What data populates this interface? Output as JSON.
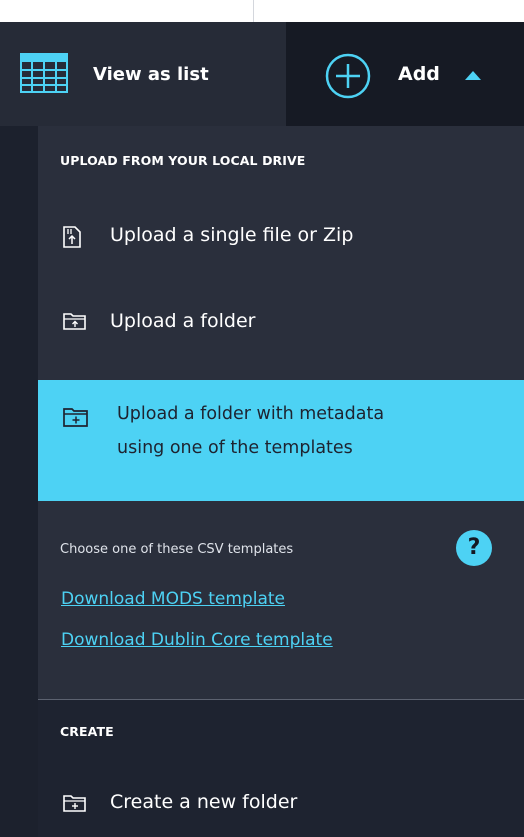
{
  "toolbar": {
    "view_as_list_label": "View as list",
    "add_label": "Add",
    "icons": {
      "view": "grid-icon",
      "add": "plus-circle-icon",
      "caret": "caret-up-icon"
    }
  },
  "upload_section": {
    "heading": "UPLOAD FROM YOUR LOCAL DRIVE",
    "items": [
      {
        "label": "Upload a single file or Zip",
        "icon": "file-upload-icon"
      },
      {
        "label": "Upload a folder",
        "icon": "folder-upload-icon"
      },
      {
        "label_line1": "Upload a folder with metadata",
        "label_line2": "using one of the templates",
        "icon": "folder-plus-icon",
        "active": true
      }
    ],
    "csv_note": "Choose one of these CSV templates",
    "links": [
      {
        "label": "Download MODS template"
      },
      {
        "label": "Download Dublin Core template"
      }
    ],
    "help_glyph": "?"
  },
  "create_section": {
    "heading": "CREATE",
    "items": [
      {
        "label": "Create a new folder",
        "icon": "folder-plus-icon"
      }
    ]
  },
  "colors": {
    "accent": "#4dd2f4",
    "menu_bg": "#2a2f3c",
    "dark_bg": "#1e2330",
    "add_bar_bg": "#161a24"
  }
}
